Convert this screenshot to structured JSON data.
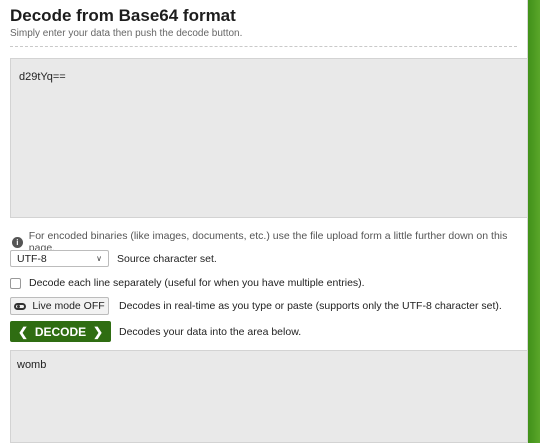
{
  "header": {
    "title": "Decode from Base64 format",
    "subtitle": "Simply enter your data then push the decode button."
  },
  "input": {
    "value": "d29tYq=="
  },
  "info": {
    "text": "For encoded binaries (like images, documents, etc.) use the file upload form a little further down on this page."
  },
  "charset": {
    "selected": "UTF-8",
    "label": "Source character set."
  },
  "separate_lines": {
    "label": "Decode each line separately (useful for when you have multiple entries)."
  },
  "live_mode": {
    "button_label": "Live mode OFF",
    "description": "Decodes in real-time as you type or paste (supports only the UTF-8 character set)."
  },
  "decode": {
    "button_label": "DECODE",
    "description": "Decodes your data into the area below."
  },
  "output": {
    "value": "womb"
  },
  "colors": {
    "accent": "#2f6d12",
    "background_green": "#4b9a1e"
  }
}
